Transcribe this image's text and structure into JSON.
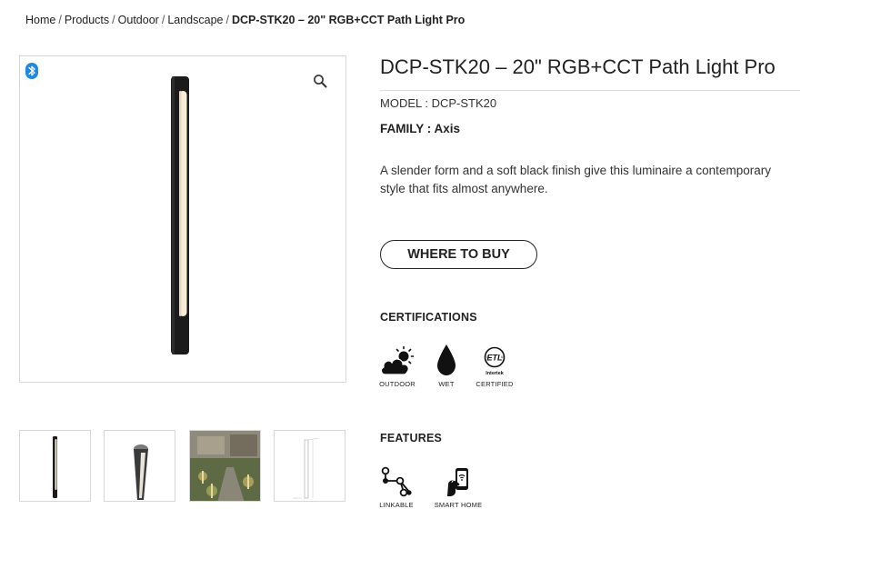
{
  "breadcrumb": {
    "items": [
      "Home",
      "Products",
      "Outdoor",
      "Landscape"
    ],
    "current": "DCP-STK20 – 20\" RGB+CCT Path Light Pro",
    "separator": "/"
  },
  "product": {
    "title": "DCP-STK20 – 20\" RGB+CCT Path Light Pro",
    "model": "MODEL : DCP-STK20",
    "family": "FAMILY : Axis",
    "description": "A slender form and a soft black finish give this luminaire a contemporary style that fits almost anywhere.",
    "buy_label": "WHERE TO BUY"
  },
  "certifications": {
    "title": "CERTIFICATIONS",
    "items": [
      {
        "label": "OUTDOOR",
        "icon": "cloud-sun-icon"
      },
      {
        "label": "WET",
        "icon": "water-drop-icon"
      },
      {
        "label": "CERTIFIED",
        "icon": "etl-listed-icon",
        "logo_text": [
          "ETL",
          "Intertek"
        ]
      }
    ]
  },
  "features": {
    "title": "FEATURES",
    "items": [
      {
        "label": "LINKABLE",
        "icon": "linkable-nodes-icon"
      },
      {
        "label": "SMART HOME",
        "icon": "smart-home-phone-icon"
      }
    ]
  },
  "gallery": {
    "main_icons": [
      "bluetooth-icon",
      "zoom-icon"
    ],
    "thumbnails": [
      "thumb-front-view",
      "thumb-angle-view",
      "thumb-garden-scene",
      "thumb-dimension-drawing"
    ]
  },
  "colors": {
    "text": "#222222",
    "border": "#d8d8d8",
    "bluetooth": "#1e88e5",
    "fixture": "#1b1b1b",
    "lens": "#f7ecd8"
  }
}
